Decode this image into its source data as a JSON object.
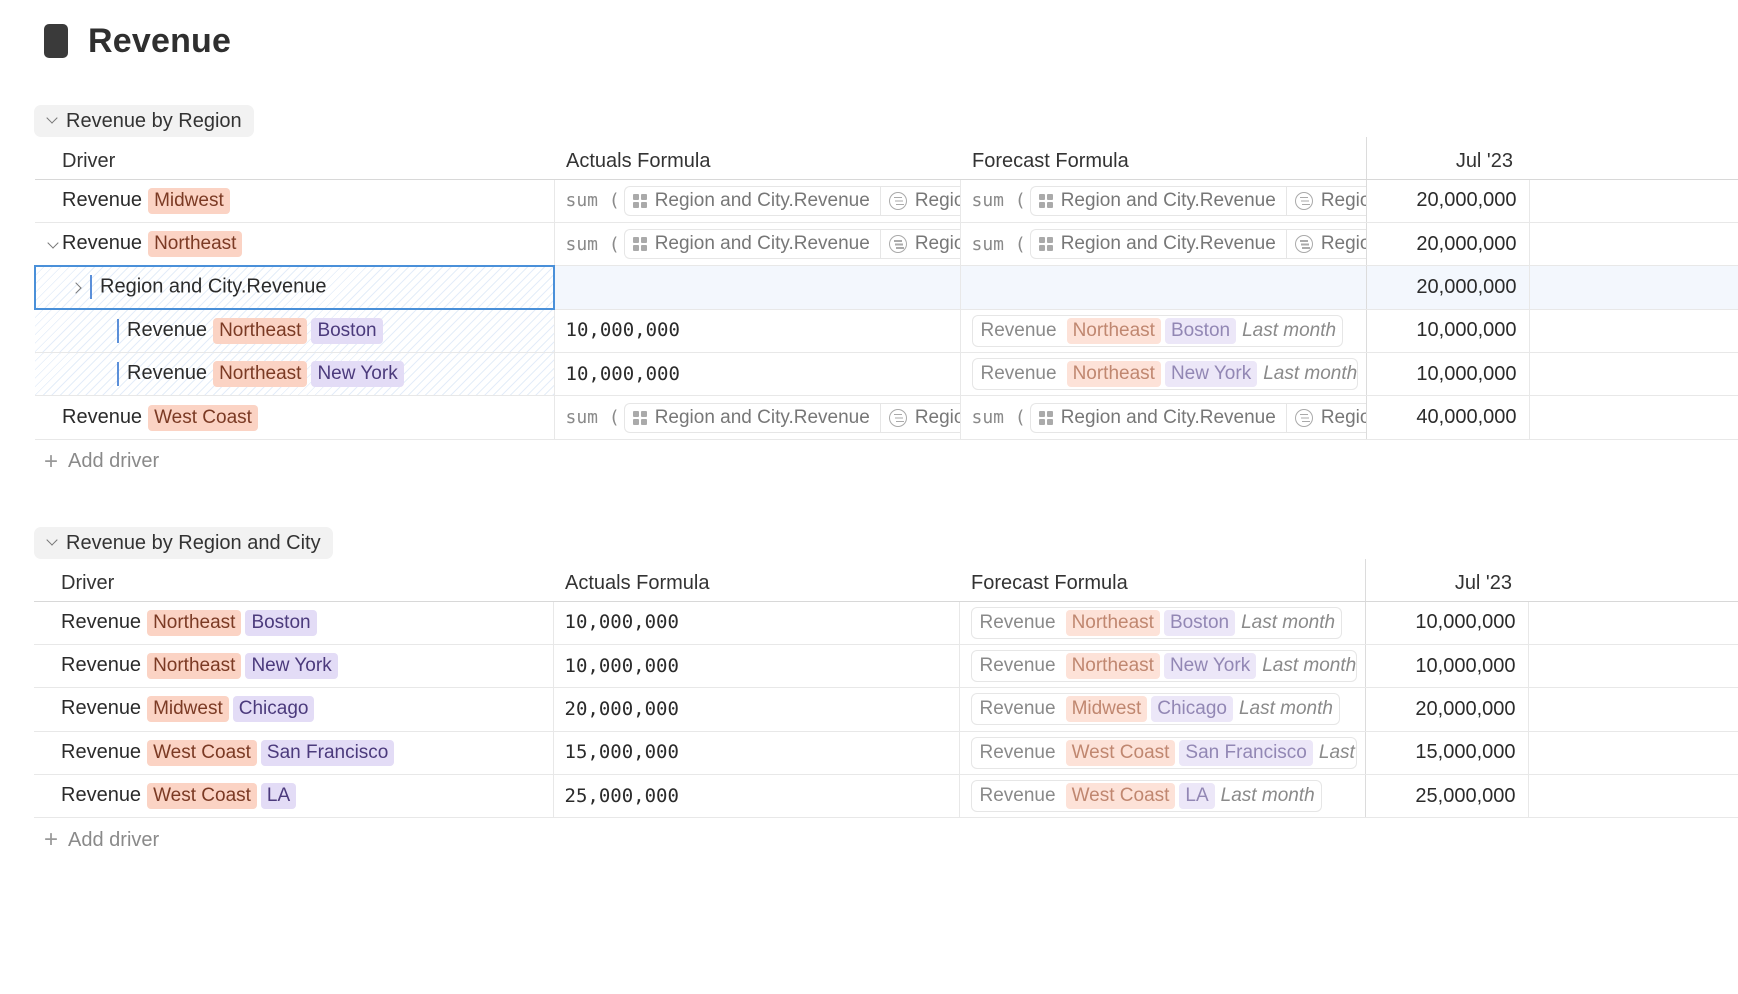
{
  "page": {
    "title": "Revenue"
  },
  "columns": {
    "driver": "Driver",
    "actuals": "Actuals Formula",
    "forecast": "Forecast Formula",
    "month": "Jul '23"
  },
  "add_driver_label": "Add driver",
  "formula": {
    "fn": "sum (",
    "source": "Region and City.Revenue",
    "filter": "Region"
  },
  "group1": {
    "title": "Revenue by Region",
    "rows": [
      {
        "name": "Revenue",
        "region": "Midwest",
        "value": "20,000,000"
      },
      {
        "name": "Revenue",
        "region": "Northeast",
        "value": "20,000,000"
      },
      {
        "name": "Region and City.Revenue",
        "value": "20,000,000"
      },
      {
        "name": "Revenue",
        "region": "Northeast",
        "city": "Boston",
        "actual": "10,000,000",
        "forecast_time": "Last month",
        "value": "10,000,000"
      },
      {
        "name": "Revenue",
        "region": "Northeast",
        "city": "New York",
        "actual": "10,000,000",
        "forecast_time": "Last month",
        "value": "10,000,000"
      },
      {
        "name": "Revenue",
        "region": "West Coast",
        "value": "40,000,000"
      }
    ]
  },
  "group2": {
    "title": "Revenue by Region and City",
    "rows": [
      {
        "name": "Revenue",
        "region": "Northeast",
        "city": "Boston",
        "actual": "10,000,000",
        "forecast_time": "Last month",
        "value": "10,000,000"
      },
      {
        "name": "Revenue",
        "region": "Northeast",
        "city": "New York",
        "actual": "10,000,000",
        "forecast_time": "Last month",
        "value": "10,000,000"
      },
      {
        "name": "Revenue",
        "region": "Midwest",
        "city": "Chicago",
        "actual": "20,000,000",
        "forecast_time": "Last month",
        "value": "20,000,000"
      },
      {
        "name": "Revenue",
        "region": "West Coast",
        "city": "San Francisco",
        "actual": "15,000,000",
        "forecast_time": "Last r",
        "value": "15,000,000"
      },
      {
        "name": "Revenue",
        "region": "West Coast",
        "city": "LA",
        "actual": "25,000,000",
        "forecast_time": "Last month",
        "value": "25,000,000"
      }
    ]
  },
  "colors": {
    "region_tag": "#fbd3c4",
    "city_tag": "#e3dcf6",
    "selection": "#4a90d9"
  }
}
